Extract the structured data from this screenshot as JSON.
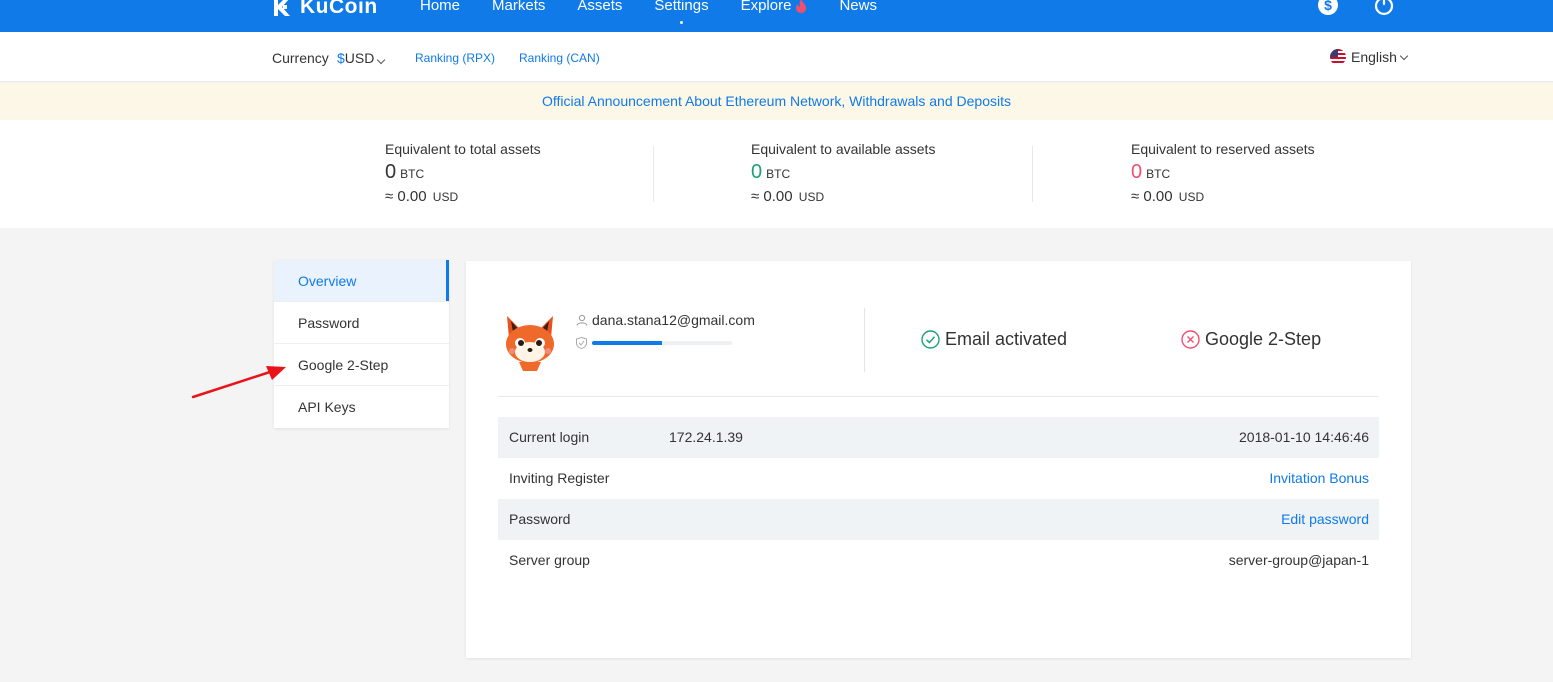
{
  "brand": {
    "name": "KuCoin",
    "color": "#0f7ae8"
  },
  "nav": {
    "items": [
      {
        "label": "Home"
      },
      {
        "label": "Markets"
      },
      {
        "label": "Assets"
      },
      {
        "label": "Settings",
        "active": true
      },
      {
        "label": "Explore",
        "icon": "fire-icon"
      },
      {
        "label": "News"
      }
    ],
    "right_icons": [
      "dollar-circle-icon",
      "power-icon"
    ]
  },
  "subbar": {
    "currency_label": "Currency",
    "currency_symbol": "$",
    "currency_value": "USD",
    "ranking_rpx": "Ranking (RPX)",
    "ranking_can": "Ranking (CAN)",
    "language": "English"
  },
  "announcement": "Official Announcement About Ethereum Network, Withdrawals and Deposits",
  "assets": {
    "total": {
      "title": "Equivalent to total assets",
      "btc": "0",
      "btc_unit": "BTC",
      "usd": "≈ 0.00",
      "usd_unit": "USD",
      "color": "#333333"
    },
    "available": {
      "title": "Equivalent to available assets",
      "btc": "0",
      "btc_unit": "BTC",
      "usd": "≈ 0.00",
      "usd_unit": "USD",
      "color": "#1aa37a"
    },
    "reserved": {
      "title": "Equivalent to reserved assets",
      "btc": "0",
      "btc_unit": "BTC",
      "usd": "≈ 0.00",
      "usd_unit": "USD",
      "color": "#f0506e"
    }
  },
  "sidemenu": {
    "items": [
      {
        "label": "Overview",
        "active": true
      },
      {
        "label": "Password"
      },
      {
        "label": "Google 2-Step"
      },
      {
        "label": "API Keys"
      }
    ]
  },
  "profile": {
    "email": "dana.stana12@gmail.com",
    "security_level": 0.5,
    "email_status": "Email activated",
    "google_status": "Google 2-Step"
  },
  "info": {
    "current_login": {
      "label": "Current login",
      "ip": "172.24.1.39",
      "time": "2018-01-10 14:46:46"
    },
    "inviting": {
      "label": "Inviting Register",
      "value": "Invitation Bonus"
    },
    "password": {
      "label": "Password",
      "value": "Edit password"
    },
    "server": {
      "label": "Server group",
      "value": "server-group@japan-1"
    }
  }
}
